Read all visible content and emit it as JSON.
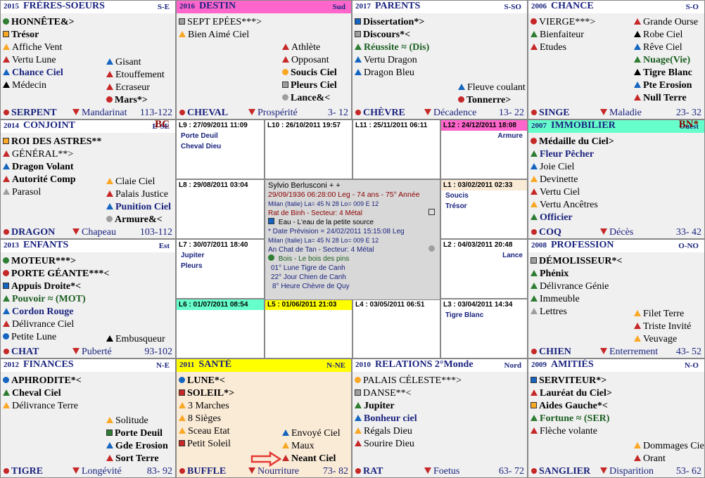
{
  "palaces": [
    {
      "key": "freres",
      "year": "2015",
      "name": "FRÈRES-SOEURS",
      "dir": "S-E",
      "hdr_bg": "#ffffff",
      "stars": [
        {
          "t": "HONNÊTE&>",
          "s": "circ",
          "c": "#2e7d32",
          "b": true
        },
        {
          "t": "Trésor",
          "s": "sq",
          "c": "#f9a825",
          "b": true
        },
        {
          "t": "Affiche Vent",
          "s": "tri",
          "c": "#f9a825",
          "b": false
        },
        {
          "t": "Vertu Lune",
          "s": "tri",
          "c": "#c62828",
          "b": false
        },
        {
          "t": "Chance Ciel",
          "s": "tri",
          "c": "#1565c0",
          "b": true,
          "col": "blue"
        },
        {
          "t": "Médecin",
          "s": "tri",
          "c": "#000000",
          "b": false
        }
      ],
      "stars2": [
        {
          "t": "Gisant",
          "s": "tri",
          "c": "#1565c0",
          "b": false
        },
        {
          "t": "Etouffement",
          "s": "tri",
          "c": "#c62828",
          "b": false
        },
        {
          "t": "Ecraseur",
          "s": "tri",
          "c": "#c62828",
          "b": false
        },
        {
          "t": "Mars*>",
          "s": "circ",
          "c": "#c62828",
          "b": true
        }
      ],
      "foot": {
        "animal": "SERPENT",
        "mini": "Mandarinat",
        "ages": "113-122"
      }
    },
    {
      "key": "destin",
      "year": "2016",
      "name": "DESTIN",
      "dir": "Sud",
      "hdr_bg": "#ff66cc",
      "stars": [
        {
          "t": "SEPT EPÉES***>",
          "s": "sq",
          "c": "#9e9e9e",
          "b": false
        },
        {
          "t": "Bien Aimé Ciel",
          "s": "tri",
          "c": "#f9a825",
          "b": false
        }
      ],
      "stars2": [
        {
          "t": "Athlète",
          "s": "tri",
          "c": "#c62828",
          "b": false
        },
        {
          "t": "Opposant",
          "s": "tri",
          "c": "#c62828",
          "b": false
        },
        {
          "t": "Soucis Ciel",
          "s": "circ",
          "c": "#f9a825",
          "b": true
        },
        {
          "t": "Pleurs Ciel",
          "s": "sq",
          "c": "#9e9e9e",
          "b": true
        },
        {
          "t": "Lance&<",
          "s": "circ",
          "c": "#9e9e9e",
          "b": true
        }
      ],
      "foot": {
        "animal": "CHEVAL",
        "mini": "Prospérité",
        "ages": "3- 12"
      }
    },
    {
      "key": "parents",
      "year": "2017",
      "name": "PARENTS",
      "dir": "S-SO",
      "hdr_bg": "#ffffff",
      "stars": [
        {
          "t": "Dissertation*>",
          "s": "sq",
          "c": "#1565c0",
          "b": true
        },
        {
          "t": "Discours*<",
          "s": "sq",
          "c": "#9e9e9e",
          "b": true
        },
        {
          "t": "Réussite ≈ (Dis)",
          "s": "tri",
          "c": "#2e7d32",
          "b": true,
          "col": "green"
        },
        {
          "t": "Vertu Dragon",
          "s": "tri",
          "c": "#1565c0",
          "b": false
        },
        {
          "t": "Dragon Bleu",
          "s": "tri",
          "c": "#1565c0",
          "b": false
        }
      ],
      "stars2": [
        {
          "t": "Fleuve coulant",
          "s": "tri",
          "c": "#1565c0",
          "b": false
        },
        {
          "t": "Tonnerre>",
          "s": "circ",
          "c": "#c62828",
          "b": true
        }
      ],
      "foot": {
        "animal": "CHÈVRE",
        "mini": "Décadence",
        "ages": "13- 22"
      }
    },
    {
      "key": "chance",
      "year": "2006",
      "name": "CHANCE",
      "dir": "S-O",
      "hdr_bg": "#ffffff",
      "stars": [
        {
          "t": "VIERGE***>",
          "s": "circ",
          "c": "#c62828",
          "b": false
        },
        {
          "t": "Bienfaiteur",
          "s": "tri",
          "c": "#2e7d32",
          "b": false
        },
        {
          "t": "Etudes",
          "s": "tri",
          "c": "#c62828",
          "b": false
        }
      ],
      "stars2": [
        {
          "t": "Grande Ourse",
          "s": "tri",
          "c": "#c62828",
          "b": false
        },
        {
          "t": "Robe Ciel",
          "s": "tri",
          "c": "#000000",
          "b": false
        },
        {
          "t": "Rêve Ciel",
          "s": "tri",
          "c": "#1565c0",
          "b": false
        },
        {
          "t": "Nuage(Vie)",
          "s": "tri",
          "c": "#2e7d32",
          "b": true,
          "col": "green"
        },
        {
          "t": "Tigre Blanc",
          "s": "tri",
          "c": "#000000",
          "b": true
        },
        {
          "t": "Pte Erosion",
          "s": "tri",
          "c": "#1565c0",
          "b": true
        },
        {
          "t": "Null Terre",
          "s": "tri",
          "c": "#c62828",
          "b": true
        }
      ],
      "foot": {
        "animal": "SINGE",
        "mini": "Maladie",
        "ages": "23- 32"
      }
    },
    {
      "key": "conjoint",
      "year": "2014",
      "name": "CONJOINT",
      "dir": "E-SE",
      "tag": "BC",
      "hdr_bg": "#ffffff",
      "stars": [
        {
          "t": "ROI DES ASTRES**",
          "s": "sq",
          "c": "#f9a825",
          "b": true
        },
        {
          "t": "GÉNÉRAL**>",
          "s": "tri",
          "c": "#c62828",
          "b": false
        },
        {
          "t": "Dragon Volant",
          "s": "tri",
          "c": "#1565c0",
          "b": true
        },
        {
          "t": "Autorité Comp",
          "s": "tri",
          "c": "#c62828",
          "b": true
        },
        {
          "t": "Parasol",
          "s": "tri",
          "c": "#9e9e9e",
          "b": false
        }
      ],
      "stars2": [
        {
          "t": "Claie Ciel",
          "s": "tri",
          "c": "#f9a825",
          "b": false
        },
        {
          "t": "Palais Justice",
          "s": "tri",
          "c": "#c62828",
          "b": false
        },
        {
          "t": "Punition Ciel",
          "s": "tri",
          "c": "#1565c0",
          "b": true,
          "col": "blue"
        },
        {
          "t": "Armure&<",
          "s": "circ",
          "c": "#9e9e9e",
          "b": true
        }
      ],
      "foot": {
        "animal": "DRAGON",
        "mini": "Chapeau",
        "ages": "103-112"
      }
    },
    {
      "key": "immobilier",
      "year": "2007",
      "name": "IMMOBILIER",
      "dir": "Ouest",
      "tag": "BN*",
      "hdr_bg": "#66ffcc",
      "stars": [
        {
          "t": "Médaille du Ciel>",
          "s": "circ",
          "c": "#c62828",
          "b": true
        },
        {
          "t": "Fleur Pêcher",
          "s": "tri",
          "c": "#2e7d32",
          "b": true,
          "col": "blue"
        },
        {
          "t": "Joie Ciel",
          "s": "tri",
          "c": "#1565c0",
          "b": false
        },
        {
          "t": "Devinette",
          "s": "tri",
          "c": "#f9a825",
          "b": false
        },
        {
          "t": "Vertu Ciel",
          "s": "tri",
          "c": "#c62828",
          "b": false
        },
        {
          "t": "Vertu Ancêtres",
          "s": "tri",
          "c": "#f9a825",
          "b": false
        },
        {
          "t": "Officier",
          "s": "tri",
          "c": "#2e7d32",
          "b": true,
          "col": "blue"
        }
      ],
      "stars2": [],
      "foot": {
        "animal": "COQ",
        "mini": "Décès",
        "ages": "33- 42"
      }
    },
    {
      "key": "enfants",
      "year": "2013",
      "name": "ENFANTS",
      "dir": "Est",
      "hdr_bg": "#ffffff",
      "stars": [
        {
          "t": "MOTEUR***>",
          "s": "circ",
          "c": "#2e7d32",
          "b": true
        },
        {
          "t": "PORTE GÉANTE***<",
          "s": "circ",
          "c": "#c62828",
          "b": true
        },
        {
          "t": "Appuis Droite*<",
          "s": "sq",
          "c": "#1565c0",
          "b": true
        },
        {
          "t": "Pouvoir ≈ (MOT)",
          "s": "tri",
          "c": "#2e7d32",
          "b": true,
          "col": "green"
        },
        {
          "t": "Cordon Rouge",
          "s": "tri",
          "c": "#1565c0",
          "b": true,
          "col": "blue"
        },
        {
          "t": "Délivrance Ciel",
          "s": "tri",
          "c": "#c62828",
          "b": false
        },
        {
          "t": "Petite Lune",
          "s": "circ",
          "c": "#1565c0",
          "b": false
        }
      ],
      "stars2": [
        {
          "t": "Embusqueur",
          "s": "tri",
          "c": "#000000",
          "b": false
        }
      ],
      "foot": {
        "animal": "CHAT",
        "mini": "Puberté",
        "ages": "93-102"
      }
    },
    {
      "key": "profession",
      "year": "2008",
      "name": "PROFESSION",
      "dir": "O-NO",
      "hdr_bg": "#ffffff",
      "stars": [
        {
          "t": "DÉMOLISSEUR*<",
          "s": "sq",
          "c": "#9e9e9e",
          "b": true
        },
        {
          "t": "Phénix",
          "s": "tri",
          "c": "#2e7d32",
          "b": true
        },
        {
          "t": "Délivrance Génie",
          "s": "tri",
          "c": "#2e7d32",
          "b": false
        },
        {
          "t": "Immeuble",
          "s": "tri",
          "c": "#2e7d32",
          "b": false
        },
        {
          "t": "Lettres",
          "s": "tri",
          "c": "#9e9e9e",
          "b": false
        }
      ],
      "stars2": [
        {
          "t": "Filet Terre",
          "s": "tri",
          "c": "#f9a825",
          "b": false
        },
        {
          "t": "Triste Invité",
          "s": "tri",
          "c": "#c62828",
          "b": false
        },
        {
          "t": "Veuvage",
          "s": "tri",
          "c": "#f9a825",
          "b": false
        }
      ],
      "foot": {
        "animal": "CHIEN",
        "mini": "Enterrement",
        "ages": "43- 52"
      }
    },
    {
      "key": "finances",
      "year": "2012",
      "name": "FINANCES",
      "dir": "N-E",
      "hdr_bg": "#ffffff",
      "stars": [
        {
          "t": "APHRODITE*<",
          "s": "circ",
          "c": "#1565c0",
          "b": true
        },
        {
          "t": "Cheval Ciel",
          "s": "tri",
          "c": "#2e7d32",
          "b": true
        },
        {
          "t": "Délivrance Terre",
          "s": "tri",
          "c": "#f9a825",
          "b": false
        }
      ],
      "stars2": [
        {
          "t": "Solitude",
          "s": "tri",
          "c": "#f9a825",
          "b": false
        },
        {
          "t": "Porte Deuil",
          "s": "sq",
          "c": "#2e7d32",
          "b": true
        },
        {
          "t": "Gde Erosion",
          "s": "tri",
          "c": "#1565c0",
          "b": true
        },
        {
          "t": "Sort Terre",
          "s": "tri",
          "c": "#c62828",
          "b": true
        }
      ],
      "foot": {
        "animal": "TIGRE",
        "mini": "Longévité",
        "ages": "83- 92"
      }
    },
    {
      "key": "sante",
      "year": "2011",
      "name": "SANTÉ",
      "dir": "N-NE",
      "hdr_bg": "#ffff00",
      "stars": [
        {
          "t": "LUNE*<",
          "s": "circ",
          "c": "#1565c0",
          "b": true
        },
        {
          "t": "SOLEIL*>",
          "s": "sq",
          "c": "#c62828",
          "b": true
        },
        {
          "t": "3 Marches",
          "s": "tri",
          "c": "#f9a825",
          "b": false
        },
        {
          "t": "8 Sièges",
          "s": "tri",
          "c": "#f9a825",
          "b": false
        },
        {
          "t": "Sceau Etat",
          "s": "tri",
          "c": "#f9a825",
          "b": false
        },
        {
          "t": "Petit Soleil",
          "s": "sq",
          "c": "#c62828",
          "b": false
        }
      ],
      "stars2": [
        {
          "t": "Envoyé Ciel",
          "s": "tri",
          "c": "#1565c0",
          "b": false
        },
        {
          "t": "Maux",
          "s": "tri",
          "c": "#f9a825",
          "b": false
        },
        {
          "t": "Neant Ciel",
          "s": "tri",
          "c": "#c62828",
          "b": true
        }
      ],
      "foot": {
        "animal": "BUFFLE",
        "mini": "Nourriture",
        "ages": "73- 82"
      }
    },
    {
      "key": "relations",
      "year": "2010",
      "name": "RELATIONS 2°Monde",
      "dir": "Nord",
      "hdr_bg": "#ffffff",
      "stars": [
        {
          "t": "PALAIS CÉLESTE***>",
          "s": "circ",
          "c": "#f9a825",
          "b": false
        },
        {
          "t": "DANSE**<",
          "s": "sq",
          "c": "#9e9e9e",
          "b": false
        },
        {
          "t": "Jupiter",
          "s": "tri",
          "c": "#2e7d32",
          "b": true
        },
        {
          "t": "Bonheur ciel",
          "s": "tri",
          "c": "#1565c0",
          "b": true,
          "col": "blue"
        },
        {
          "t": "Régals Dieu",
          "s": "tri",
          "c": "#f9a825",
          "b": false
        },
        {
          "t": "Sourire Dieu",
          "s": "tri",
          "c": "#c62828",
          "b": false
        }
      ],
      "stars2": [],
      "foot": {
        "animal": "RAT",
        "mini": "Foetus",
        "ages": "63- 72"
      }
    },
    {
      "key": "amities",
      "year": "2009",
      "name": "AMITIÉS",
      "dir": "N-O",
      "hdr_bg": "#ffffff",
      "stars": [
        {
          "t": "SERVITEUR*>",
          "s": "sq",
          "c": "#1565c0",
          "b": true
        },
        {
          "t": "Lauréat du Ciel>",
          "s": "tri",
          "c": "#c62828",
          "b": true
        },
        {
          "t": "Aides Gauche*<",
          "s": "sq",
          "c": "#f9a825",
          "b": true
        },
        {
          "t": "Fortune ≈ (SER)",
          "s": "tri",
          "c": "#2e7d32",
          "b": true,
          "col": "green"
        },
        {
          "t": "Flèche volante",
          "s": "tri",
          "c": "#c62828",
          "b": false
        }
      ],
      "stars2": [
        {
          "t": "Dommages Ciel",
          "s": "tri",
          "c": "#f9a825",
          "b": false
        },
        {
          "t": "Orant",
          "s": "tri",
          "c": "#c62828",
          "b": false
        }
      ],
      "foot": {
        "animal": "SANGLIER",
        "mini": "Disparition",
        "ages": "53- 62"
      }
    }
  ],
  "grid": [
    {
      "label": "L9 : 27/09/2011 11:09",
      "bg": "#ffffff",
      "items": [
        "Porte Deuil",
        "Cheval Dieu"
      ]
    },
    {
      "label": "L10 : 26/10/2011 19:57",
      "bg": "#ffffff",
      "items": []
    },
    {
      "label": "L11 : 25/11/2011 06:11",
      "bg": "#ffffff",
      "items": []
    },
    {
      "label": "L12 : 24/12/2011 18:08",
      "bg": "#ff66cc",
      "items": [
        "Armure"
      ]
    },
    {
      "label": "L8 : 29/08/2011 03:04",
      "bg": "#ffffff",
      "items": []
    },
    {
      "label": "L1 : 03/02/2011 02:33",
      "bg": "#faebd7",
      "items": [
        "Soucis",
        "Trésor"
      ]
    },
    {
      "label": "L7 : 30/07/2011 18:40",
      "bg": "#ffffff",
      "items": [
        "Jupiter",
        "Pleurs"
      ]
    },
    {
      "label": "L2 : 04/03/2011 20:48",
      "bg": "#ffffff",
      "items": [
        "Lance"
      ]
    },
    {
      "label": "L6 : 01/07/2011 08:54",
      "bg": "#66ffcc",
      "items": []
    },
    {
      "label": "L5 : 01/06/2011 21:03",
      "bg": "#ffff00",
      "items": []
    },
    {
      "label": "L4 : 03/05/2011 06:51",
      "bg": "#ffffff",
      "items": []
    },
    {
      "label": "L3 : 03/04/2011 14:34",
      "bg": "#ffffff",
      "items": [
        "Tigre Blanc"
      ]
    }
  ],
  "center": {
    "name": "Sylvio Berlusconi  + +",
    "birth": "29/09/1936 06:28:00 Leg - 74 ans - 75° Année",
    "place": "Milan (Italie) La= 45 N 28   Lo= 009 E 12",
    "sector1": "Rat de Binh  -  Secteur:  4 Métal",
    "element1": "Eau  -  L'eau de la petite source",
    "prevision": "* Date Prévision  =  24/02/2011 15:15:08 Leg",
    "place2": "Milan (Italie) La= 45 N 28   Lo= 009 E 12",
    "sector2": "An Chat de Tan  -  Secteur:  4 Métal",
    "element2": "Bois  -  Le bois des pins",
    "lune": "01° Lune  Tigre de Canh",
    "jour": "22° Jour Chien de Canh",
    "heure": "8° Heure Chèvre de Quy"
  }
}
